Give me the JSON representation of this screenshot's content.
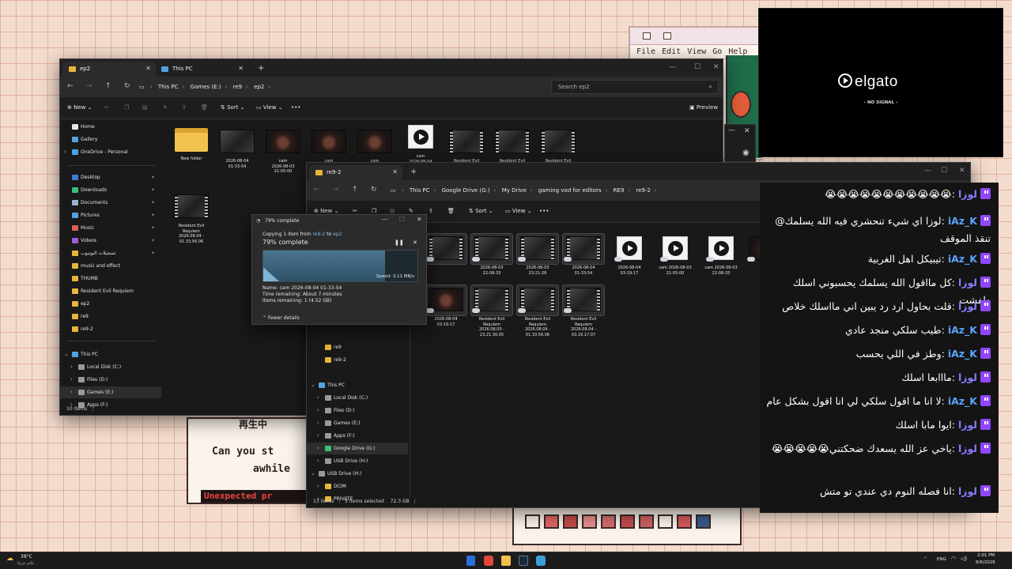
{
  "colors": {
    "accent_folder": "#f2c24f",
    "twitch_purple": "#9146ff",
    "user_luza": "#8a7cff",
    "user_iaz": "#5aa4ff",
    "explorer_bg": "#191919"
  },
  "retro_game": {
    "menu": [
      "File",
      "Edit",
      "View",
      "Go",
      "Help"
    ],
    "cn_text": "再生中",
    "line1": "Can you st",
    "line2": "awhile",
    "banner": "Unexpected pr"
  },
  "explorer_back": {
    "tabs": [
      {
        "label": "ep2",
        "icon": "folder-icon"
      },
      {
        "label": "This PC",
        "icon": "pc-icon"
      }
    ],
    "breadcrumb": [
      "This PC",
      "Games (E:)",
      "re9",
      "ep2"
    ],
    "search_placeholder": "Search ep2",
    "commands": {
      "new": "New",
      "sort": "Sort",
      "view": "View",
      "preview": "Preview"
    },
    "nav": [
      {
        "label": "Home",
        "color": "#e6e6e6"
      },
      {
        "label": "Gallery",
        "color": "#4fa3e0"
      },
      {
        "label": "OneDrive - Personal",
        "color": "#4fa3e0"
      },
      {
        "label": "Desktop",
        "color": "#3d7bd6"
      },
      {
        "label": "Downloads",
        "color": "#3dbf7c"
      },
      {
        "label": "Documents",
        "color": "#9bb4cf"
      },
      {
        "label": "Pictures",
        "color": "#4fa3e0"
      },
      {
        "label": "Music",
        "color": "#e05b5b"
      },
      {
        "label": "Videos",
        "color": "#a25bd6"
      },
      {
        "label": "تسجيلات اليوتيوب",
        "color": "#e8b53c"
      },
      {
        "label": "music and effect",
        "color": "#e8b53c"
      },
      {
        "label": "THUMB",
        "color": "#e8b53c"
      },
      {
        "label": "Resident Evil Requiem",
        "color": "#e8b53c"
      },
      {
        "label": "ep2",
        "color": "#e8b53c"
      },
      {
        "label": "re9",
        "color": "#e8b53c"
      },
      {
        "label": "re9-2",
        "color": "#e8b53c"
      },
      {
        "label": "This PC",
        "color": "#4fa3e0"
      },
      {
        "label": "Local Disk (C:)",
        "color": "#9a9a9a"
      },
      {
        "label": "Files (D:)",
        "color": "#9a9a9a"
      },
      {
        "label": "Games (E:)",
        "color": "#9a9a9a"
      },
      {
        "label": "Apps (F:)",
        "color": "#9a9a9a"
      }
    ],
    "files": [
      {
        "name": "New folder",
        "kind": "folder"
      },
      {
        "name": "2026-08-04\n01-33-54",
        "kind": "video"
      },
      {
        "name": "cam\n2026-08-03\n21-05-00",
        "kind": "person"
      },
      {
        "name": "cam\n2026-08-03\n22-08-33",
        "kind": "person"
      },
      {
        "name": "cam\n2026-08-03\n23-21-28",
        "kind": "person"
      },
      {
        "name": "cam\n2026-08-04\n01-33-54",
        "kind": "doc"
      },
      {
        "name": "Resident Evil\nRequiem",
        "kind": "film"
      },
      {
        "name": "Resident Evil\nRequiem",
        "kind": "film"
      },
      {
        "name": "Resident Evil\nRequiem",
        "kind": "film"
      },
      {
        "name": "Resident Evil\nRequiem\n2026.08.04 -\n01.33.56.06",
        "kind": "film"
      }
    ],
    "status": "10 items"
  },
  "explorer_front": {
    "tabs": [
      {
        "label": "re9-2",
        "icon": "folder-icon"
      }
    ],
    "breadcrumb": [
      "This PC",
      "Google Drive (G:)",
      "My Drive",
      "gaming vod for editors",
      "RE9",
      "re9-2"
    ],
    "commands": {
      "new": "New",
      "sort": "Sort",
      "view": "View"
    },
    "nav": [
      {
        "label": "re9",
        "color": "#e8b53c"
      },
      {
        "label": "re9-2",
        "color": "#e8b53c"
      },
      {
        "label": "This PC",
        "color": "#4fa3e0"
      },
      {
        "label": "Local Disk (C:)",
        "color": "#9a9a9a"
      },
      {
        "label": "Files (D:)",
        "color": "#9a9a9a"
      },
      {
        "label": "Games (E:)",
        "color": "#9a9a9a"
      },
      {
        "label": "Apps (F:)",
        "color": "#9a9a9a"
      },
      {
        "label": "Google Drive (G:)",
        "color": "#3dbf7c"
      },
      {
        "label": "USB Drive (H:)",
        "color": "#9a9a9a"
      },
      {
        "label": "USB Drive (H:)",
        "color": "#9a9a9a"
      },
      {
        "label": "DCIM",
        "color": "#e8b53c"
      },
      {
        "label": "PRIVATE",
        "color": "#e8b53c"
      }
    ],
    "files_row1": [
      {
        "name": "",
        "kind": "film"
      },
      {
        "name": "2026-08-03\n22-08-33",
        "kind": "film"
      },
      {
        "name": "2026-08-03\n23-21-28",
        "kind": "film"
      },
      {
        "name": "2026-08-04\n01-33-54",
        "kind": "film"
      },
      {
        "name": "2026-08-04\n03-19-17",
        "kind": "doc"
      },
      {
        "name": "cam 2026-08-03\n21-05-00",
        "kind": "doc"
      },
      {
        "name": "cam 2026-08-03\n22-08-33",
        "kind": "doc"
      },
      {
        "name": "cam",
        "kind": "person"
      }
    ],
    "files_row2": [
      {
        "name": "2026-08-04\n03-19-17",
        "kind": "person"
      },
      {
        "name": "Resident Evil\nRequiem\n2026.08.03 -\n23.21.30.05",
        "kind": "film"
      },
      {
        "name": "Resident Evil\nRequiem\n2026.08.04 -\n01.33.56.06",
        "kind": "film"
      },
      {
        "name": "Resident Evil\nRequiem\n2026.08.04 -\n03.19.17.07",
        "kind": "film"
      }
    ],
    "status_items": "13 items",
    "status_selected": "5 items selected",
    "status_size": "72.3 GB"
  },
  "copy_dialog": {
    "title": "79% complete",
    "copying_prefix": "Copying 1 item from ",
    "from": "re9-2",
    "to_word": " to ",
    "to": "ep2",
    "percent_text": "79% complete",
    "progress": 0.79,
    "speed": "Speed: 3.11 MB/s",
    "name": "Name:  cam 2026-08-04 01-33-54",
    "time_remaining": "Time remaining:  About 7 minutes",
    "items_remaining": "Items remaining:  1 (4.52 GB)",
    "fewer_details": "Fewer details"
  },
  "elgato": {
    "brand": "elgato",
    "status": "- NO SIGNAL -"
  },
  "chat": [
    {
      "user": "لوزا",
      "user_kind": "luza",
      "text": "😭😭😭😭😭😭😭😭😭😭😭"
    },
    {
      "user": "iAz_K",
      "user_kind": "iaz",
      "text": "لوزا اي شيء تنحشري فيه الله يسلمك@ تنقذ الموقف"
    },
    {
      "user": "iAz_K",
      "user_kind": "iaz",
      "text": "تيبيكل اهل الغربية"
    },
    {
      "user": "لوزا",
      "user_kind": "luza",
      "text": "كل مااقول الله يسلمك يحسبوني اسلك طفشت"
    },
    {
      "user": "لوزا",
      "user_kind": "luza",
      "text": "قلت بحاول ارد رد يبين اني مااسلك خلاص"
    },
    {
      "user": "iAz_K",
      "user_kind": "iaz",
      "text": "طيب سلكي منجد عادي"
    },
    {
      "user": "iAz_K",
      "user_kind": "iaz",
      "text": "وطز في اللي يحسب"
    },
    {
      "user": "لوزا",
      "user_kind": "luza",
      "text": "مااابعا اسلك"
    },
    {
      "user": "iAz_K",
      "user_kind": "iaz",
      "text": "لا انا ما اقول سلكي لي انا اقول بشكل عام"
    },
    {
      "user": "لوزا",
      "user_kind": "luza",
      "text": "ايوا مابا اسلك"
    },
    {
      "user": "لوزا",
      "user_kind": "luza",
      "text": "ياخي عز الله يسعدك ضحكتني😭😭😭😭😭"
    },
    {
      "user": "لوزا",
      "user_kind": "luza",
      "text": "انا فصله النوم دي عندي تو متش"
    }
  ],
  "taskbar": {
    "weather_temp": "38°C",
    "weather_desc": "غائم جزئيا",
    "language": "ENG",
    "time": "2:01 PM",
    "date": "8/6/2026"
  }
}
